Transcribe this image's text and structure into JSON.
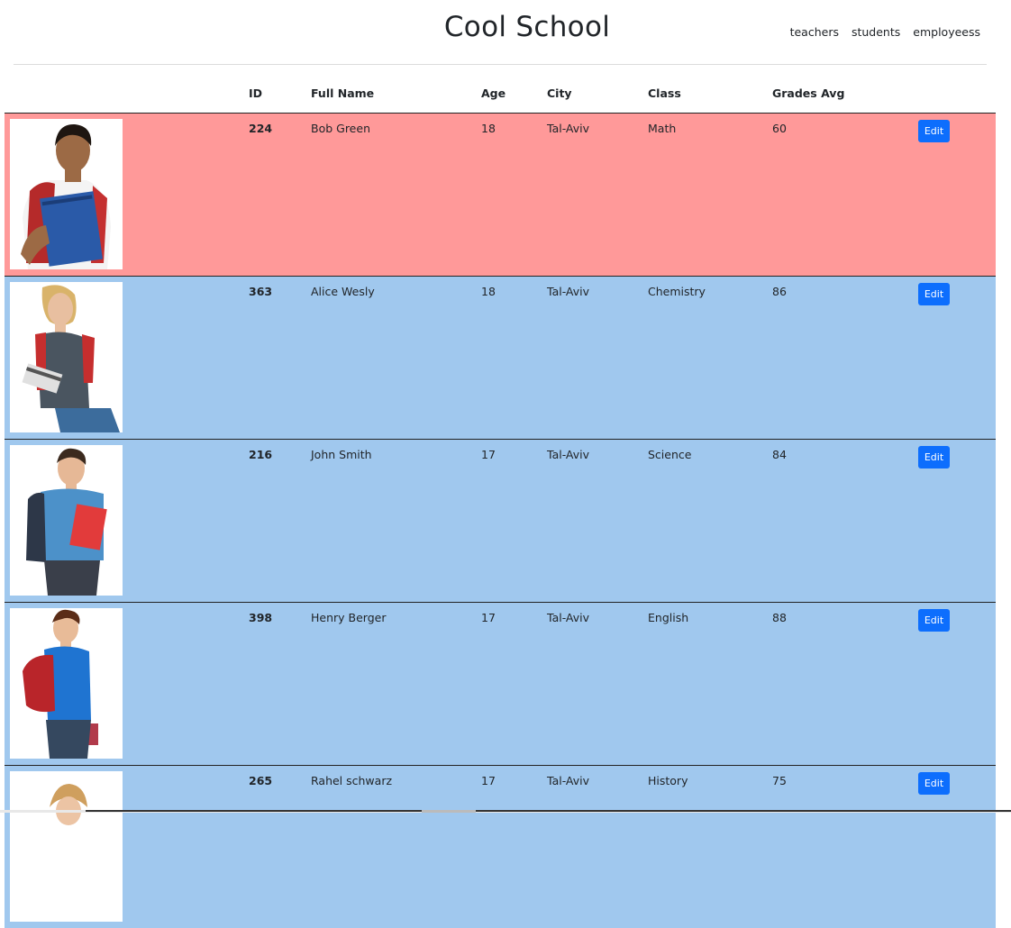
{
  "header": {
    "title": "Cool School",
    "nav": [
      "teachers",
      "students",
      "employeess"
    ]
  },
  "table": {
    "headers": [
      "ID",
      "Full Name",
      "Age",
      "City",
      "Class",
      "Grades Avg"
    ],
    "edit_label": "Edit",
    "rows": [
      {
        "id": "224",
        "name": "Bob Green",
        "age": "18",
        "city": "Tal-Aviv",
        "class": "Math",
        "grade": "60",
        "color": "#ff9999",
        "photo": "student-boy-backpack"
      },
      {
        "id": "363",
        "name": "Alice Wesly",
        "age": "18",
        "city": "Tal-Aviv",
        "class": "Chemistry",
        "grade": "86",
        "color": "#a0c8ee",
        "photo": "student-girl-backpack"
      },
      {
        "id": "216",
        "name": "John Smith",
        "age": "17",
        "city": "Tal-Aviv",
        "class": "Science",
        "grade": "84",
        "color": "#a0c8ee",
        "photo": "student-boy-blue-shirt"
      },
      {
        "id": "398",
        "name": "Henry Berger",
        "age": "17",
        "city": "Tal-Aviv",
        "class": "English",
        "grade": "88",
        "color": "#a0c8ee",
        "photo": "student-boy-red-backpack"
      },
      {
        "id": "265",
        "name": "Rahel schwarz",
        "age": "17",
        "city": "Tal-Aviv",
        "class": "History",
        "grade": "75",
        "color": "#a0c8ee",
        "photo": "student-girl"
      }
    ]
  },
  "colors": {
    "accent_button": "#0d6efd",
    "highlight_row": "#ff9999",
    "normal_row": "#a0c8ee"
  }
}
